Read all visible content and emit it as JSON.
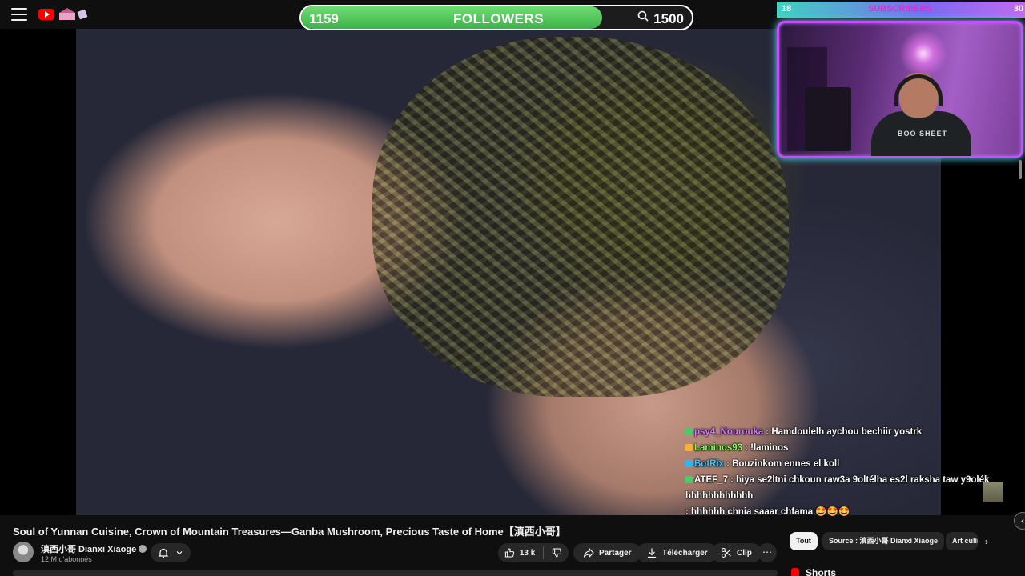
{
  "overlay": {
    "followers_goal": {
      "current": "1159",
      "label": "FOLLOWERS",
      "target": "1500",
      "progress": 0.77
    },
    "subscribers_goal": {
      "current": "18",
      "label": "SUBSCRIBERS",
      "target": "30"
    },
    "webcam": {
      "shirt_text": "BOO SHEET"
    },
    "chat": [
      {
        "user": "psy4_Nourouka",
        "user_color": "#d27bff",
        "message": "Hamdoulelh aychou bechiir yostrk"
      },
      {
        "user": "Laminos93",
        "user_color": "#7dff5a",
        "message": "!laminos"
      },
      {
        "user": "BotRix",
        "user_color": "#3ec7ff",
        "message": "Bouzinkom ennes el koll"
      },
      {
        "user": "ATEF_7",
        "user_color": "#ffffff",
        "message": "hiya se2ltni chkoun raw3a 9oltélha es2l raksha taw y9olék hhhhhhhhhhhh"
      },
      {
        "user": "",
        "user_color": "#ffffff",
        "message": "hhhhhh chnia saaar chfama 🤩🤩🤩"
      }
    ]
  },
  "video": {
    "title": "Soul of Yunnan Cuisine, Crown of Mountain Treasures—Ganba Mushroom, Precious Taste of Home【滇西小哥】",
    "channel_name": "滇西小哥 Dianxi Xiaoge",
    "subscribers": "12 M d'abonnés",
    "likes": "13 k",
    "actions": {
      "share": "Partager",
      "download": "Télécharger",
      "clip": "Clip",
      "more": "⋯"
    }
  },
  "sidebar": {
    "chips": [
      "Tout",
      "Source : 滇西小哥 Dianxi Xiaoge",
      "Art culinaire"
    ],
    "section": "Shorts"
  },
  "colors": {
    "accent": "#ff0000",
    "goal_fill": "#4cc954",
    "webcam_border": "#c94cff"
  },
  "icons": [
    "menu-icon",
    "youtube-logo",
    "search-icon",
    "bell-icon",
    "chevron-down-icon",
    "like-icon",
    "dislike-icon",
    "share-icon",
    "download-icon",
    "clip-icon",
    "more-icon",
    "chevron-right-icon",
    "shorts-icon",
    "verified-icon"
  ]
}
